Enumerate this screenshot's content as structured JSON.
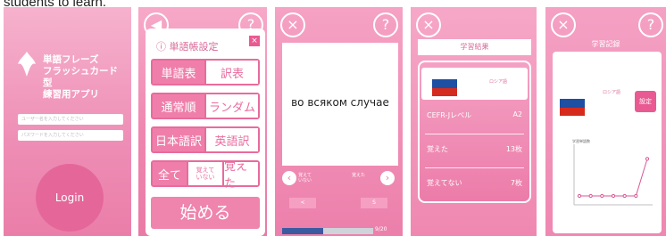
{
  "caption": "students to learn.",
  "app": {
    "logo_lines": [
      "単語フレーズ",
      "フラッシュカード型",
      "練習用アプリ"
    ],
    "username_placeholder": "ユーザー名を入力してください",
    "password_placeholder": "パスワードを入力してください",
    "login_label": "Login"
  },
  "settings": {
    "title": "単語帳設定",
    "close": "×",
    "rows": [
      [
        "単語表",
        "訳表"
      ],
      [
        "通常順",
        "ランダム"
      ],
      [
        "日本語訳",
        "英語訳"
      ],
      [
        "全て",
        "覚えて\nいない",
        "覚えた"
      ]
    ],
    "start_label": "始める"
  },
  "flashcard": {
    "word": "во всяком случае",
    "prev_label": "覚えて\nいない",
    "next_label": "覚えた",
    "box_left": "<",
    "box_right": "S",
    "progress_text": "9/20",
    "progress_fraction": 0.45
  },
  "results": {
    "title": "学習結果",
    "language": "ロシア語",
    "stats": [
      {
        "label": "CEFR-Jレベル",
        "value": "A2"
      },
      {
        "label": "覚えた",
        "value": "13枚"
      },
      {
        "label": "覚えてない",
        "value": "7枚"
      }
    ]
  },
  "history": {
    "title": "学習記録",
    "language": "ロシア語",
    "setting_label": "設定",
    "chart_title": "学習単語数",
    "chart_values": [
      0,
      0,
      0,
      0,
      0,
      0,
      20
    ],
    "colors": {
      "line": "#d85794",
      "point": "#d85794",
      "axis": "#bfbfbf"
    }
  },
  "colors": {
    "pink": "#ef7faa",
    "flag_white": "#ffffff",
    "flag_blue": "#1d4fa3",
    "flag_red": "#d52b1e"
  }
}
